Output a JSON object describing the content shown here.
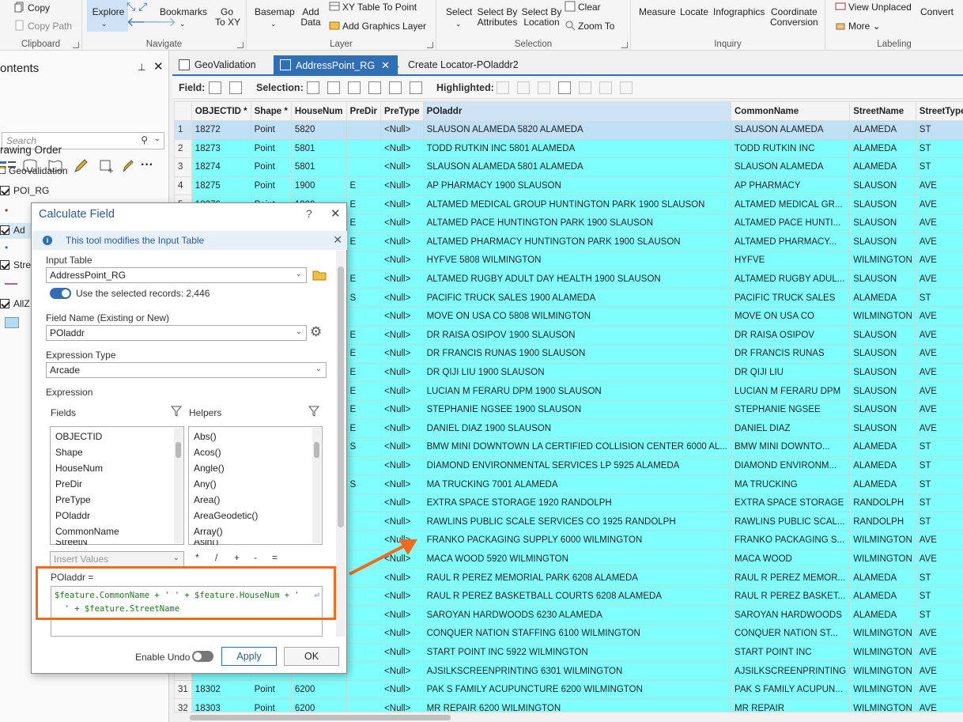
{
  "ribbon": {
    "clipboard": {
      "copy": "Copy",
      "copy_path": "Copy Path",
      "label": "Clipboard"
    },
    "navigate": {
      "explore": "Explore",
      "bookmarks": "Bookmarks",
      "goto": "Go\nTo XY",
      "label": "Navigate"
    },
    "layer": {
      "basemap": "Basemap",
      "add_data": "Add\nData",
      "xy_table": "XY Table To Point",
      "add_graphics": "Add Graphics Layer",
      "label": "Layer"
    },
    "selection": {
      "select": "Select",
      "by_attributes": "Select By\nAttributes",
      "by_location": "Select By\nLocation",
      "clear": "Clear",
      "zoom_to": "Zoom To",
      "label": "Selection"
    },
    "inquiry": {
      "measure": "Measure",
      "locate": "Locate",
      "infographics": "Infographics",
      "coordinate": "Coordinate\nConversion",
      "label": "Inquiry"
    },
    "labeling": {
      "view_unplaced": "View Unplaced",
      "more": "More",
      "convert": "Convert",
      "label": "Labeling"
    }
  },
  "contents": {
    "title": "ontents",
    "search_placeholder": "Search",
    "drawing_order": "rawing Order",
    "layers": [
      "GeoValidation",
      "POI_RG",
      "Ad",
      "Stre",
      "AllZ"
    ]
  },
  "tabs": [
    {
      "label": "GeoValidation"
    },
    {
      "label": "AddressPoint_RG"
    },
    {
      "label": "Create Locator-POladdr2"
    }
  ],
  "table_toolbar": {
    "field": "Field:",
    "selection": "Selection:",
    "highlighted": "Highlighted:"
  },
  "grid": {
    "columns": [
      "OBJECTID *",
      "Shape *",
      "HouseNum",
      "PreDir",
      "PreType",
      "POladdr",
      "CommonName",
      "StreetName",
      "StreetType"
    ],
    "rows": [
      [
        "1",
        "18272",
        "Point",
        "5820",
        "",
        "<Null>",
        "SLAUSON ALAMEDA 5820 ALAMEDA",
        "SLAUSON ALAMEDA",
        "ALAMEDA",
        "ST"
      ],
      [
        "2",
        "18273",
        "Point",
        "5801",
        "",
        "<Null>",
        "TODD RUTKIN INC 5801 ALAMEDA",
        "TODD RUTKIN INC",
        "ALAMEDA",
        "ST"
      ],
      [
        "3",
        "18274",
        "Point",
        "5801",
        "",
        "<Null>",
        "SLAUSON ALAMEDA 5801 ALAMEDA",
        "SLAUSON ALAMEDA",
        "ALAMEDA",
        "ST"
      ],
      [
        "4",
        "18275",
        "Point",
        "1900",
        "E",
        "<Null>",
        "AP PHARMACY 1900 SLAUSON",
        "AP PHARMACY",
        "SLAUSON",
        "AVE"
      ],
      [
        "5",
        "18276",
        "Point",
        "1900",
        "E",
        "<Null>",
        "ALTAMED MEDICAL GROUP HUNTINGTON PARK 1900 SLAUSON",
        "ALTAMED MEDICAL GR...",
        "SLAUSON",
        "AVE"
      ],
      [
        "6",
        "",
        "",
        "",
        "E",
        "<Null>",
        "ALTAMED PACE HUNTINGTON PARK 1900 SLAUSON",
        "ALTAMED PACE HUNTI...",
        "SLAUSON",
        "AVE"
      ],
      [
        "7",
        "",
        "",
        "",
        "E",
        "<Null>",
        "ALTAMED PHARMACY HUNTINGTON PARK 1900 SLAUSON",
        "ALTAMED PHARMACY...",
        "SLAUSON",
        "AVE"
      ],
      [
        "8",
        "",
        "",
        "",
        "",
        "<Null>",
        "HYFVE 5808 WILMINGTON",
        "HYFVE",
        "WILMINGTON",
        "AVE"
      ],
      [
        "9",
        "",
        "",
        "",
        "E",
        "<Null>",
        "ALTAMED RUGBY ADULT DAY HEALTH 1900 SLAUSON",
        "ALTAMED RUGBY ADUL...",
        "SLAUSON",
        "AVE"
      ],
      [
        "10",
        "",
        "",
        "",
        "S",
        "<Null>",
        "PACIFIC TRUCK SALES 1900 ALAMEDA",
        "PACIFIC TRUCK SALES",
        "ALAMEDA",
        "ST"
      ],
      [
        "11",
        "",
        "",
        "",
        "",
        "<Null>",
        "MOVE ON USA CO 5808 WILMINGTON",
        "MOVE ON USA CO",
        "WILMINGTON",
        "AVE"
      ],
      [
        "12",
        "",
        "",
        "",
        "E",
        "<Null>",
        "DR RAISA OSIPOV 1900 SLAUSON",
        "DR RAISA OSIPOV",
        "SLAUSON",
        "AVE"
      ],
      [
        "13",
        "",
        "",
        "",
        "E",
        "<Null>",
        "DR FRANCIS RUNAS 1900 SLAUSON",
        "DR FRANCIS RUNAS",
        "SLAUSON",
        "AVE"
      ],
      [
        "14",
        "",
        "",
        "",
        "E",
        "<Null>",
        "DR QIJI LIU 1900 SLAUSON",
        "DR QIJI LIU",
        "SLAUSON",
        "AVE"
      ],
      [
        "15",
        "",
        "",
        "",
        "E",
        "<Null>",
        "LUCIAN M FERARU DPM 1900 SLAUSON",
        "LUCIAN M FERARU DPM",
        "SLAUSON",
        "AVE"
      ],
      [
        "16",
        "",
        "",
        "",
        "E",
        "<Null>",
        "STEPHANIE NGSEE 1900 SLAUSON",
        "STEPHANIE NGSEE",
        "SLAUSON",
        "AVE"
      ],
      [
        "17",
        "",
        "",
        "",
        "E",
        "<Null>",
        "DANIEL DIAZ 1900 SLAUSON",
        "DANIEL DIAZ",
        "SLAUSON",
        "AVE"
      ],
      [
        "18",
        "",
        "",
        "",
        "S",
        "<Null>",
        "BMW MINI DOWNTOWN LA CERTIFIED COLLISION CENTER 6000 AL...",
        "BMW MINI DOWNTO...",
        "ALAMEDA",
        "ST"
      ],
      [
        "19",
        "",
        "",
        "",
        "",
        "<Null>",
        "DIAMOND ENVIRONMENTAL SERVICES LP 5925 ALAMEDA",
        "DIAMOND ENVIRONM...",
        "ALAMEDA",
        "ST"
      ],
      [
        "20",
        "",
        "",
        "",
        "S",
        "<Null>",
        "MA TRUCKING 7001 ALAMEDA",
        "MA TRUCKING",
        "ALAMEDA",
        "ST"
      ],
      [
        "21",
        "",
        "",
        "",
        "",
        "<Null>",
        "EXTRA SPACE STORAGE 1920 RANDOLPH",
        "EXTRA SPACE STORAGE",
        "RANDOLPH",
        "ST"
      ],
      [
        "22",
        "",
        "",
        "",
        "",
        "<Null>",
        "RAWLINS PUBLIC SCALE SERVICES CO 1925 RANDOLPH",
        "RAWLINS PUBLIC SCAL...",
        "RANDOLPH",
        "ST"
      ],
      [
        "23",
        "",
        "",
        "",
        "",
        "<Null>",
        "FRANKO PACKAGING SUPPLY 6000 WILMINGTON",
        "FRANKO PACKAGING S...",
        "WILMINGTON",
        "AVE"
      ],
      [
        "24",
        "",
        "",
        "",
        "",
        "<Null>",
        "MACA WOOD 5920 WILMINGTON",
        "MACA WOOD",
        "WILMINGTON",
        "AVE"
      ],
      [
        "25",
        "",
        "",
        "",
        "",
        "<Null>",
        "RAUL R PEREZ MEMORIAL PARK 6208 ALAMEDA",
        "RAUL R PEREZ MEMOR...",
        "ALAMEDA",
        "ST"
      ],
      [
        "26",
        "",
        "",
        "",
        "",
        "<Null>",
        "RAUL R PEREZ BASKETBALL COURTS 6208 ALAMEDA",
        "RAUL R PEREZ BASKET...",
        "ALAMEDA",
        "ST"
      ],
      [
        "27",
        "",
        "",
        "",
        "",
        "<Null>",
        "SAROYAN HARDWOODS 6230 ALAMEDA",
        "SAROYAN HARDWOODS",
        "ALAMEDA",
        "ST"
      ],
      [
        "28",
        "",
        "",
        "",
        "",
        "<Null>",
        "CONQUER NATION STAFFING 6100 WILMINGTON",
        "CONQUER NATION ST...",
        "WILMINGTON",
        "AVE"
      ],
      [
        "29",
        "",
        "",
        "",
        "",
        "<Null>",
        "START POINT INC 5922 WILMINGTON",
        "START POINT INC",
        "WILMINGTON",
        "AVE"
      ],
      [
        "30",
        "18301",
        "Point",
        "6301",
        "",
        "<Null>",
        "AJSILKSCREENPRINTING 6301 WILMINGTON",
        "AJSILKSCREENPRINTING",
        "WILMINGTON",
        "AVE"
      ],
      [
        "31",
        "18302",
        "Point",
        "6200",
        "",
        "<Null>",
        "PAK S FAMILY ACUPUNCTURE 6200 WILMINGTON",
        "PAK S FAMILY ACUPUN...",
        "WILMINGTON",
        "AVE"
      ],
      [
        "32",
        "18303",
        "Point",
        "6200",
        "",
        "<Null>",
        "MR REPAIR 6200 WILMINGTON",
        "MR REPAIR",
        "WILMINGTON",
        "AVE"
      ]
    ]
  },
  "dialog": {
    "title": "Calculate Field",
    "help": "?",
    "info": "This tool modifies the Input Table",
    "input_table_label": "Input Table",
    "input_table_value": "AddressPoint_RG",
    "use_selected": "Use the selected records: 2,446",
    "field_name_label": "Field Name (Existing or New)",
    "field_name_value": "POladdr",
    "expr_type_label": "Expression Type",
    "expr_type_value": "Arcade",
    "expression_label": "Expression",
    "fields_label": "Fields",
    "helpers_label": "Helpers",
    "fields": [
      "OBJECTID",
      "Shape",
      "HouseNum",
      "PreDir",
      "PreType",
      "POladdr",
      "CommonName",
      "StreetN"
    ],
    "helpers": [
      "Abs()",
      "Acos()",
      "Angle()",
      "Any()",
      "Area()",
      "AreaGeodetic()",
      "Array()",
      "Asin()"
    ],
    "insert_values": "Insert Values",
    "operators": [
      "*",
      "/",
      "+",
      "-",
      "="
    ],
    "expr_target": "POladdr =",
    "expr_line1": "$feature.CommonName + ' ' + $feature.HouseNum + '",
    "expr_line2": "  ' + $feature.StreetName",
    "enable_undo": "Enable Undo",
    "apply": "Apply",
    "ok": "OK"
  },
  "colors": {
    "accent": "#2f6fb5",
    "selected_row": "#80ffff",
    "annotation": "#f26a1b"
  }
}
